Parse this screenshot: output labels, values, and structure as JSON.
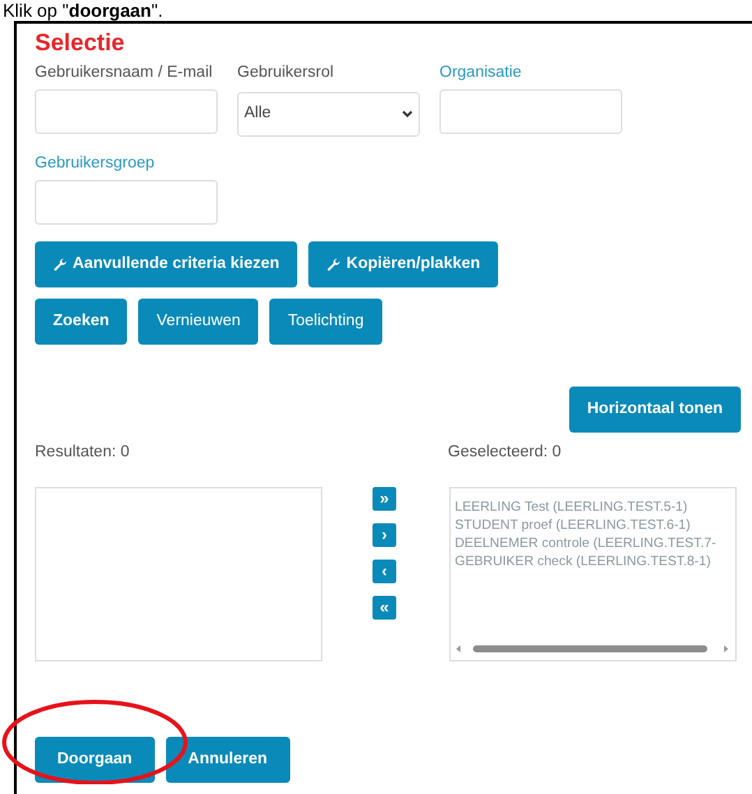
{
  "instruction": "Klik op \"**doorgaan**\".",
  "title": "Selectie",
  "fields": [
    {
      "label": "Gebruikersnaam / E-mail",
      "kind": "text",
      "label_is_link": false
    },
    {
      "label": "Gebruikersrol",
      "kind": "select",
      "value": "Alle",
      "label_is_link": false
    },
    {
      "label": "Organisatie",
      "kind": "text",
      "label_is_link": true
    },
    {
      "label": "Gebruikersgroep",
      "kind": "text",
      "label_is_link": true
    }
  ],
  "criteria_buttons": [
    {
      "label": "Aanvullende criteria kiezen",
      "has_icon": true
    },
    {
      "label": "Kopiëren/plakken",
      "has_icon": true
    }
  ],
  "action_buttons": [
    {
      "label": "Zoeken",
      "bold": true
    },
    {
      "label": "Vernieuwen",
      "bold": false
    },
    {
      "label": "Toelichting",
      "bold": false
    }
  ],
  "layout_button": "Horizontaal tonen",
  "results": {
    "label": "Resultaten: 0"
  },
  "selection": {
    "label": "Geselecteerd: 0",
    "items": [
      "LEERLING Test (LEERLING.TEST.5-1)",
      "STUDENT proef (LEERLING.TEST.6-1)",
      "DEELNEMER controle (LEERLING.TEST.7-",
      "GEBRUIKER check (LEERLING.TEST.8-1)"
    ]
  },
  "transfer_buttons": [
    "»",
    "›",
    "‹",
    "«"
  ],
  "footer_buttons": [
    {
      "label": "Doorgaan",
      "circled": true
    },
    {
      "label": "Annuleren",
      "circled": false
    }
  ]
}
